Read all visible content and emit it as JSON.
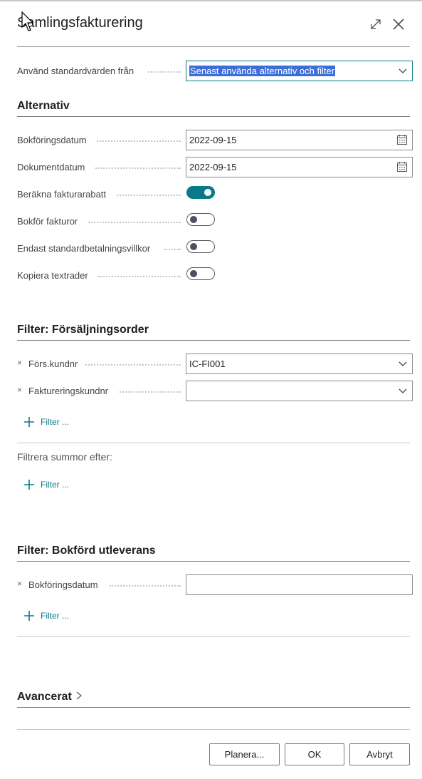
{
  "dialog": {
    "title": "Samlingsfakturering",
    "expand_icon": "expand-icon",
    "close_icon": "close-icon"
  },
  "defaults": {
    "label": "Använd standardvärden från",
    "value": "Senast använda alternativ och filter"
  },
  "options": {
    "title": "Alternativ",
    "posting_date": {
      "label": "Bokföringsdatum",
      "value": "2022-09-15"
    },
    "document_date": {
      "label": "Dokumentdatum",
      "value": "2022-09-15"
    },
    "calc_invoice_discount": {
      "label": "Beräkna fakturarabatt",
      "on": true
    },
    "post_invoices": {
      "label": "Bokför fakturor",
      "on": false
    },
    "only_std_payment_terms": {
      "label": "Endast standardbetalningsvillkor",
      "on": false
    },
    "copy_text_lines": {
      "label": "Kopiera textrader",
      "on": false
    }
  },
  "filter_sales": {
    "title": "Filter: Försäljningsorder",
    "remove_symbol": "×",
    "rows": [
      {
        "label": "Förs.kundnr",
        "value": "IC-FI001"
      },
      {
        "label": "Faktureringskundnr",
        "value": ""
      }
    ],
    "add_filter": "Filter ...",
    "totals_label": "Filtrera summor efter:",
    "totals_add_filter": "Filter ..."
  },
  "filter_shipment": {
    "title": "Filter: Bokförd utleverans",
    "remove_symbol": "×",
    "rows": [
      {
        "label": "Bokföringsdatum",
        "value": ""
      }
    ],
    "add_filter": "Filter ..."
  },
  "advanced": {
    "title": "Avancerat"
  },
  "footer": {
    "schedule": "Planera...",
    "ok": "OK",
    "cancel": "Avbryt"
  },
  "colors": {
    "accent": "#0a7a8a",
    "selection": "#3c6ed7"
  }
}
